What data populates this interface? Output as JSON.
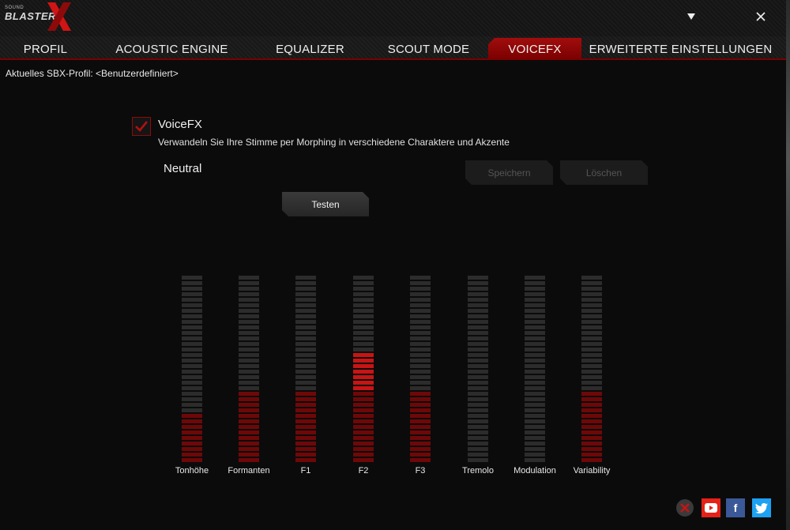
{
  "app": {
    "logo_small": "SOUND",
    "logo_main": "BLASTER"
  },
  "window": {
    "minimize_icon": "chevron-down",
    "close_icon": "close"
  },
  "tabs": [
    {
      "label": "PROFIL"
    },
    {
      "label": "ACOUSTIC ENGINE"
    },
    {
      "label": "EQUALIZER"
    },
    {
      "label": "SCOUT MODE"
    },
    {
      "label": "VOICEFX",
      "active": true
    },
    {
      "label": "ERWEITERTE EINSTELLUNGEN"
    }
  ],
  "profile_line": "Aktuelles SBX-Profil: <Benutzerdefiniert>",
  "voicefx": {
    "enabled": true,
    "title": "VoiceFX",
    "description": "Verwandeln Sie Ihre Stimme per Morphing in verschiedene Charaktere und Akzente",
    "preset": "Neutral",
    "save_label": "Speichern",
    "delete_label": "Löschen",
    "test_label": "Testen"
  },
  "sliders": [
    {
      "label": "Tonhöhe",
      "level": 0.25
    },
    {
      "label": "Formanten",
      "level": 0.37
    },
    {
      "label": "F1",
      "level": 0.37
    },
    {
      "label": "F2",
      "level": 0.6
    },
    {
      "label": "F3",
      "level": 0.37
    },
    {
      "label": "Tremolo",
      "level": 0
    },
    {
      "label": "Modulation",
      "level": 0
    },
    {
      "label": "Variability",
      "level": 0.37
    }
  ],
  "social": [
    {
      "name": "close-circle",
      "color": "#c81414"
    },
    {
      "name": "youtube",
      "color": "#e62117"
    },
    {
      "name": "facebook",
      "color": "#3b5998"
    },
    {
      "name": "twitter",
      "color": "#1da1f2"
    }
  ],
  "colors": {
    "accent": "#a10d0d",
    "segment_off": "#2c2c2c",
    "segment_on": "#6e0808",
    "segment_hot": "#c81414"
  }
}
